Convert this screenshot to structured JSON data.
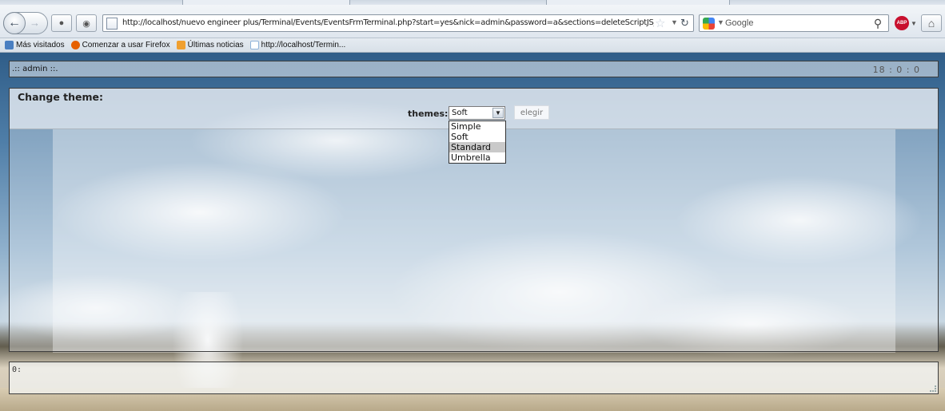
{
  "browser": {
    "url": "http://localhost/nuevo engineer plus/Terminal/Events/EventsFrmTerminal.php?start=yes&nick=admin&password=a&sections=deleteScriptJS_unRegiste",
    "search_engine": "Google",
    "icons": {
      "back": "arrow-left-icon",
      "forward": "arrow-right-icon",
      "reload": "reload-icon",
      "bookmark_star": "star-icon",
      "search": "magnifier-icon",
      "home": "home-icon",
      "adblock": "abp-icon"
    },
    "adblock_label": "ABP"
  },
  "bookmarks": [
    {
      "label": "Más visitados",
      "icon_color": "#4a7fc1"
    },
    {
      "label": "Comenzar a usar Firefox",
      "icon_color": "#e66000"
    },
    {
      "label": "Últimas noticias",
      "icon_color": "#f0a030"
    },
    {
      "label": "http://localhost/Termin...",
      "icon_color": "#8fb3d9"
    }
  ],
  "header": {
    "user": ".:: admin ::.",
    "clock": "18 : 0 : 0"
  },
  "theme_panel": {
    "title": "Change theme:",
    "label": "themes:",
    "selected": "Soft",
    "options": [
      "Simple",
      "Soft",
      "Standard",
      "Umbrella"
    ],
    "highlighted_option": "Standard",
    "button": "elegir"
  },
  "status": {
    "text": "0:"
  }
}
